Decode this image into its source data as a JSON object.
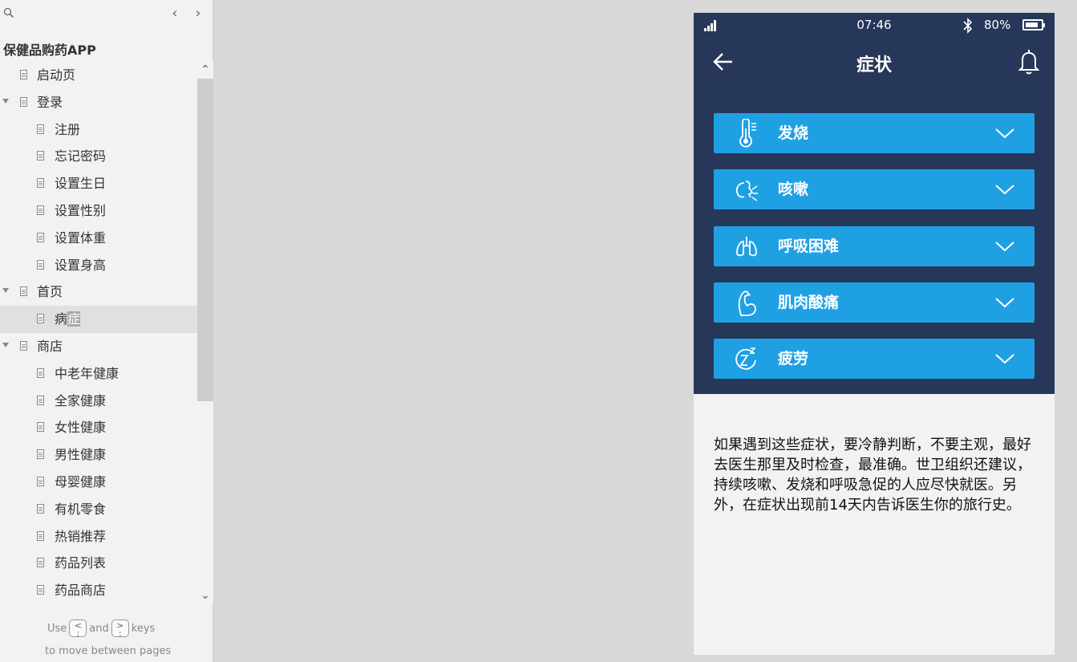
{
  "sidebar": {
    "project_title": "保健品购药APP",
    "items": [
      {
        "label": "启动页",
        "level": 1,
        "expandable": false
      },
      {
        "label": "登录",
        "level": 1,
        "expandable": true
      },
      {
        "label": "注册",
        "level": 2,
        "expandable": false
      },
      {
        "label": "忘记密码",
        "level": 2,
        "expandable": false
      },
      {
        "label": "设置生日",
        "level": 2,
        "expandable": false
      },
      {
        "label": "设置性别",
        "level": 2,
        "expandable": false
      },
      {
        "label": "设置体重",
        "level": 2,
        "expandable": false
      },
      {
        "label": "设置身高",
        "level": 2,
        "expandable": false
      },
      {
        "label": "首页",
        "level": 1,
        "expandable": true
      },
      {
        "label": "病症",
        "level": 2,
        "expandable": false,
        "selected": true
      },
      {
        "label": "商店",
        "level": 1,
        "expandable": true
      },
      {
        "label": "中老年健康",
        "level": 2,
        "expandable": false
      },
      {
        "label": "全家健康",
        "level": 2,
        "expandable": false
      },
      {
        "label": "女性健康",
        "level": 2,
        "expandable": false
      },
      {
        "label": "男性健康",
        "level": 2,
        "expandable": false
      },
      {
        "label": "母婴健康",
        "level": 2,
        "expandable": false
      },
      {
        "label": "有机零食",
        "level": 2,
        "expandable": false
      },
      {
        "label": "热销推荐",
        "level": 2,
        "expandable": false
      },
      {
        "label": "药品列表",
        "level": 2,
        "expandable": false
      },
      {
        "label": "药品商店",
        "level": 2,
        "expandable": false
      }
    ],
    "footer": {
      "use": "Use",
      "prev_key": "<",
      "and": "and",
      "next_key": ">",
      "keys": "keys",
      "line2": "to move between pages"
    }
  },
  "phone": {
    "status_bar": {
      "time": "07:46",
      "battery": "80%",
      "battery_level": 0.8
    },
    "nav": {
      "title": "症状",
      "back_icon": "arrow-left-icon",
      "bell_icon": "bell-icon"
    },
    "symptoms": [
      {
        "label": "发烧",
        "icon": "thermometer-icon"
      },
      {
        "label": "咳嗽",
        "icon": "cough-icon"
      },
      {
        "label": "呼吸困难",
        "icon": "lungs-icon"
      },
      {
        "label": "肌肉酸痛",
        "icon": "muscle-arm-icon"
      },
      {
        "label": "疲劳",
        "icon": "sleep-zz-icon"
      }
    ],
    "advice": "如果遇到这些症状，要冷静判断，不要主观，最好去医生那里及时检查，最准确。世卫组织还建议，持续咳嗽、发烧和呼吸急促的人应尽快就医。另外，在症状出现前14天内告诉医生你的旅行史。"
  },
  "colors": {
    "header_bg": "#27375a",
    "accent": "#1fa0e3",
    "page_bg": "#f2f2f2",
    "canvas_bg": "#d8d8d8"
  }
}
